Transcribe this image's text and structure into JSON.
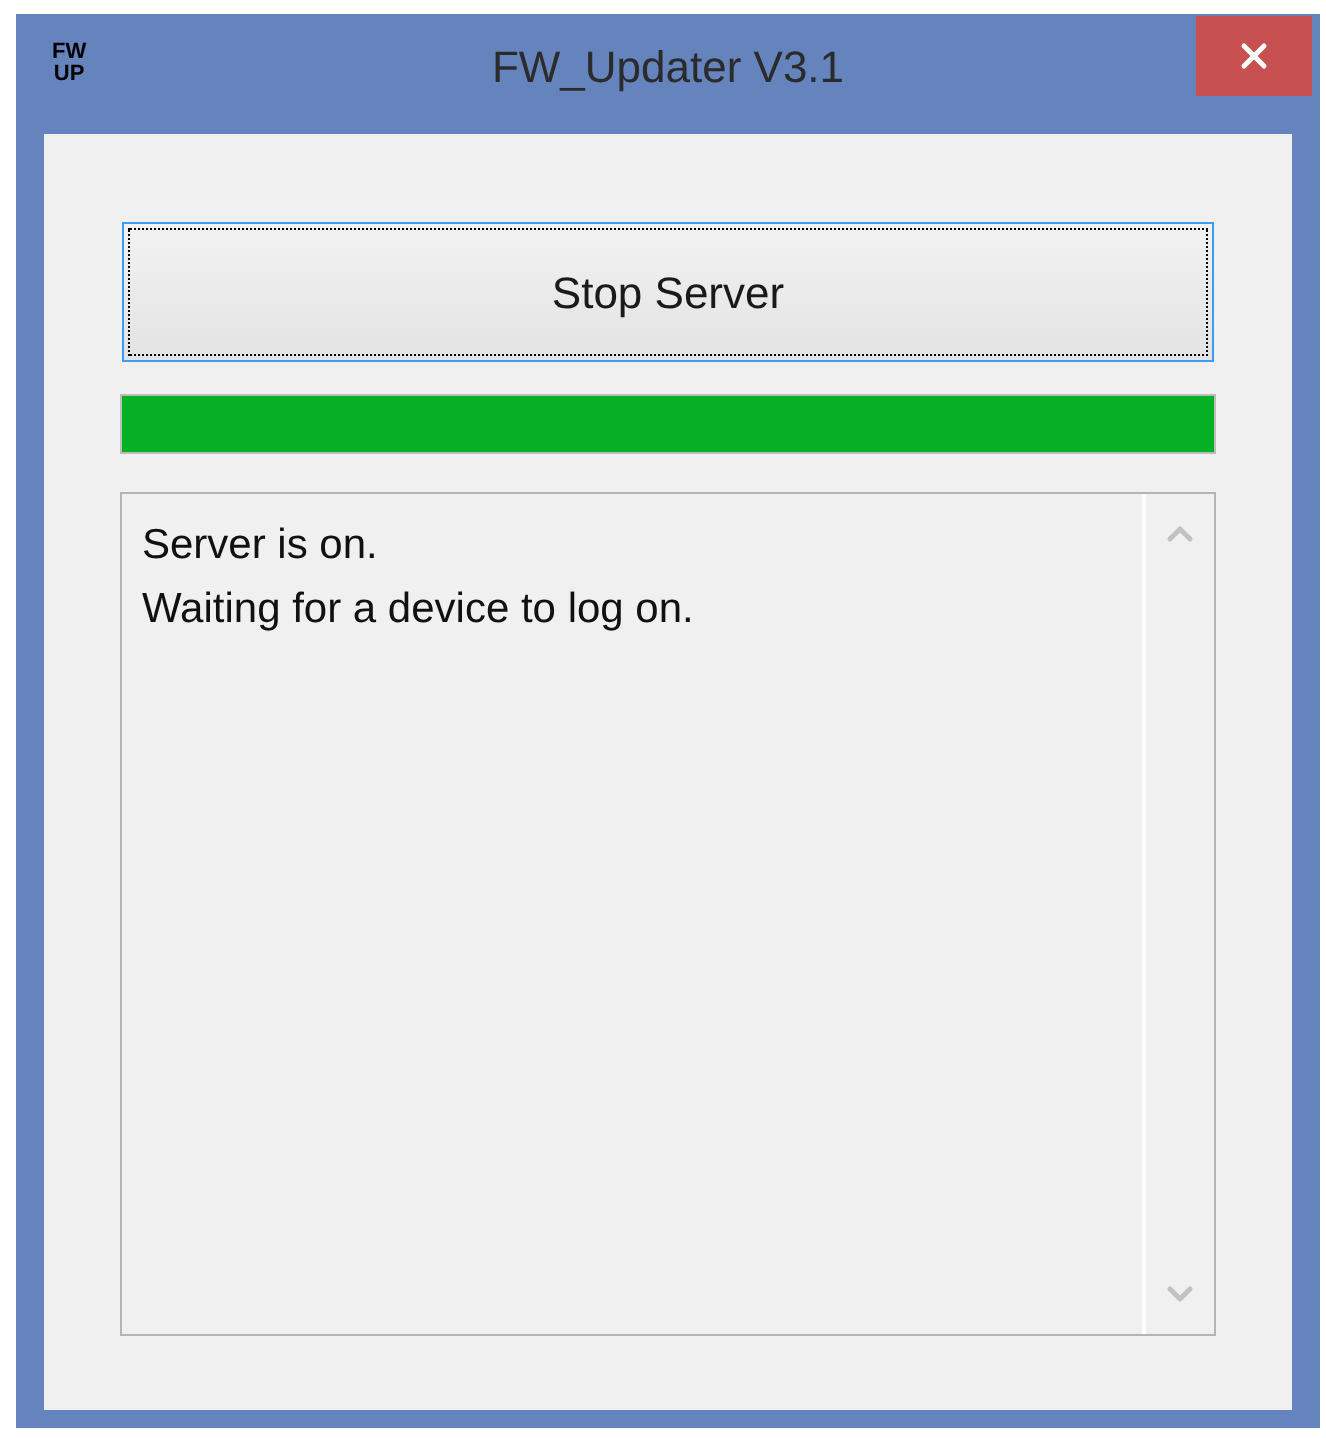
{
  "window": {
    "title": "FW_Updater V3.1",
    "logo": [
      "FW",
      "UP"
    ]
  },
  "button": {
    "label": "Stop Server",
    "focused": true
  },
  "progress": {
    "level": 1
  },
  "log": {
    "lines": [
      "Server is on.",
      "Waiting for a device to log on."
    ]
  }
}
